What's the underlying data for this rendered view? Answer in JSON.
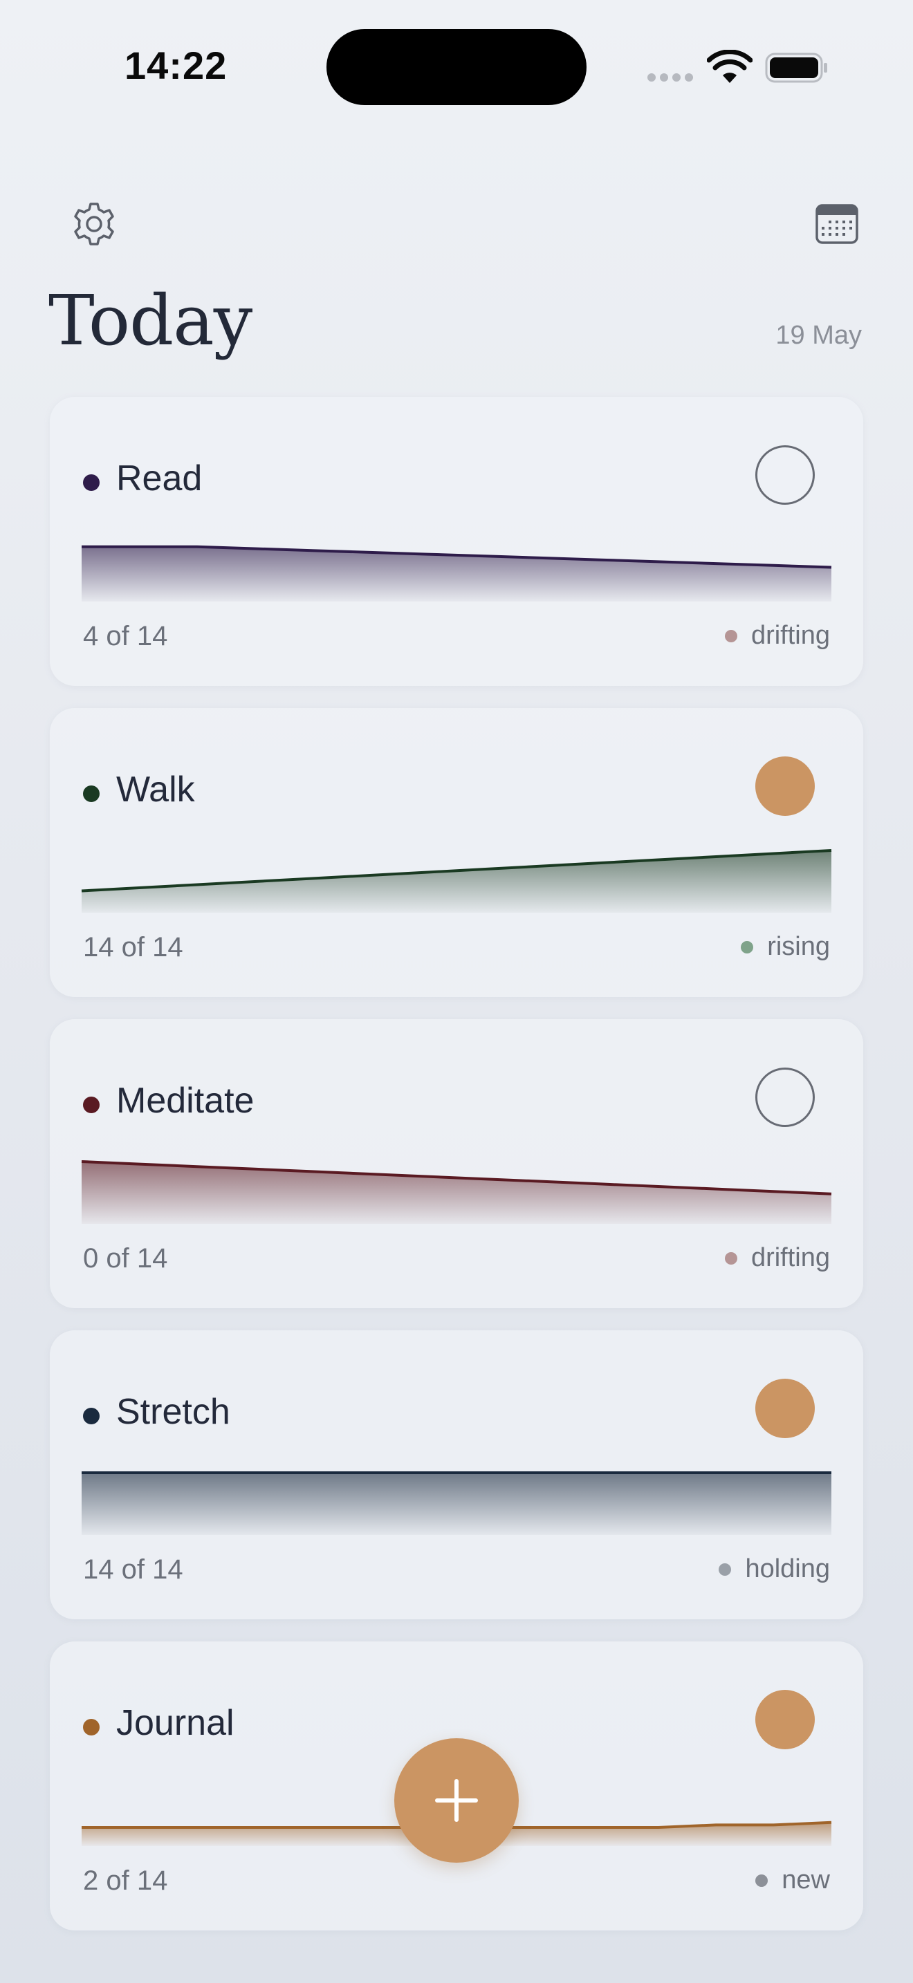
{
  "status_bar": {
    "time": "14:22"
  },
  "header": {
    "title": "Today",
    "date": "19 May",
    "settings_icon": "gear-icon",
    "calendar_icon": "calendar-icon"
  },
  "habits": [
    {
      "name": "Read",
      "color": "#2e1c4a",
      "done": false,
      "count": "4 of 14",
      "trend": "drifting",
      "trend_color": "#b59595",
      "sparkline": [
        0.88,
        0.88,
        0.88,
        0.85,
        0.82,
        0.79,
        0.76,
        0.73,
        0.7,
        0.67,
        0.64,
        0.61,
        0.58,
        0.55
      ]
    },
    {
      "name": "Walk",
      "color": "#1a3a22",
      "done": true,
      "count": "14 of 14",
      "trend": "rising",
      "trend_color": "#7fa38a",
      "sparkline": [
        0.35,
        0.4,
        0.45,
        0.5,
        0.55,
        0.6,
        0.65,
        0.7,
        0.75,
        0.8,
        0.85,
        0.9,
        0.95,
        1.0
      ]
    },
    {
      "name": "Meditate",
      "color": "#5a1a22",
      "done": false,
      "count": "0 of 14",
      "trend": "drifting",
      "trend_color": "#b59595",
      "sparkline": [
        1.0,
        0.96,
        0.92,
        0.88,
        0.84,
        0.8,
        0.76,
        0.72,
        0.68,
        0.64,
        0.6,
        0.56,
        0.52,
        0.48
      ]
    },
    {
      "name": "Stretch",
      "color": "#1a2a3e",
      "done": true,
      "count": "14 of 14",
      "trend": "holding",
      "trend_color": "#9aa0a8",
      "sparkline": [
        1.0,
        1.0,
        1.0,
        1.0,
        1.0,
        1.0,
        1.0,
        1.0,
        1.0,
        1.0,
        1.0,
        1.0,
        1.0,
        1.0
      ]
    },
    {
      "name": "Journal",
      "color": "#a0642a",
      "done": true,
      "count": "2 of 14",
      "trend": "new",
      "trend_color": "#8c9098",
      "sparkline": [
        0.3,
        0.3,
        0.3,
        0.3,
        0.3,
        0.3,
        0.3,
        0.3,
        0.3,
        0.3,
        0.3,
        0.34,
        0.34,
        0.38
      ]
    }
  ],
  "fab": {
    "icon": "plus-icon",
    "color": "#cb9563"
  }
}
